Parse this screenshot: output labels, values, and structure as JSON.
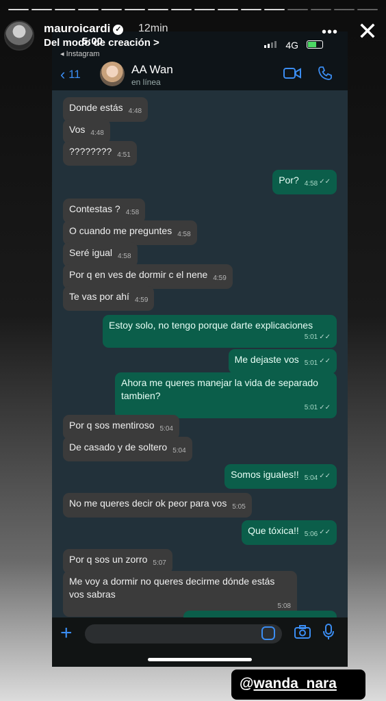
{
  "story": {
    "username": "mauroicardi",
    "time_ago": "12min",
    "source": "Del modo de creación >",
    "mention_prefix": "@",
    "mention": "wanda_nara"
  },
  "status_bar": {
    "clock": "5:00",
    "back_app": "◂ Instagram",
    "network": "4G"
  },
  "chat_header": {
    "back_count": "11",
    "contact_name": "AA Wan",
    "contact_status": "en línea"
  },
  "messages": [
    {
      "dir": "in",
      "text": "Donde estás",
      "time": "4:48"
    },
    {
      "dir": "in",
      "text": "Vos",
      "time": "4:48"
    },
    {
      "dir": "in",
      "text": "????????",
      "time": "4:51"
    },
    {
      "dir": "out",
      "text": "Por?",
      "time": "4:58"
    },
    {
      "dir": "in",
      "text": "Contestas ?",
      "time": "4:58"
    },
    {
      "dir": "in",
      "text": "O cuando me preguntes",
      "time": "4:58"
    },
    {
      "dir": "in",
      "text": "Seré igual",
      "time": "4:58"
    },
    {
      "dir": "in",
      "text": "Por q en ves de dormir c el nene",
      "time": "4:59"
    },
    {
      "dir": "in",
      "text": "Te vas por ahí",
      "time": "4:59"
    },
    {
      "dir": "out",
      "text": "Estoy solo, no tengo porque darte explicaciones",
      "time": "5:01"
    },
    {
      "dir": "out",
      "text": "Me dejaste vos",
      "time": "5:01"
    },
    {
      "dir": "out",
      "text": "Ahora me queres manejar la vida de separado tambien?",
      "time": "5:01"
    },
    {
      "dir": "in",
      "text": "Por q sos mentiroso",
      "time": "5:04"
    },
    {
      "dir": "in",
      "text": "De casado y de soltero",
      "time": "5:04"
    },
    {
      "dir": "out",
      "text": "Somos iguales!!",
      "time": "5:04"
    },
    {
      "dir": "in",
      "text": "No me queres decir ok peor para vos",
      "time": "5:05"
    },
    {
      "dir": "out",
      "text": "Que tóxica!!",
      "time": "5:06"
    },
    {
      "dir": "in",
      "text": "Por q sos un zorro",
      "time": "5:07"
    },
    {
      "dir": "in",
      "text": "Me voy a dormir no queres decirme dónde estás vos sabras",
      "time": "5:08"
    }
  ],
  "colors": {
    "accent": "#3b8df2",
    "incoming_bubble": "#3b3b3b",
    "outgoing_bubble": "#0b5e4a",
    "chat_bg": "#22313a"
  }
}
